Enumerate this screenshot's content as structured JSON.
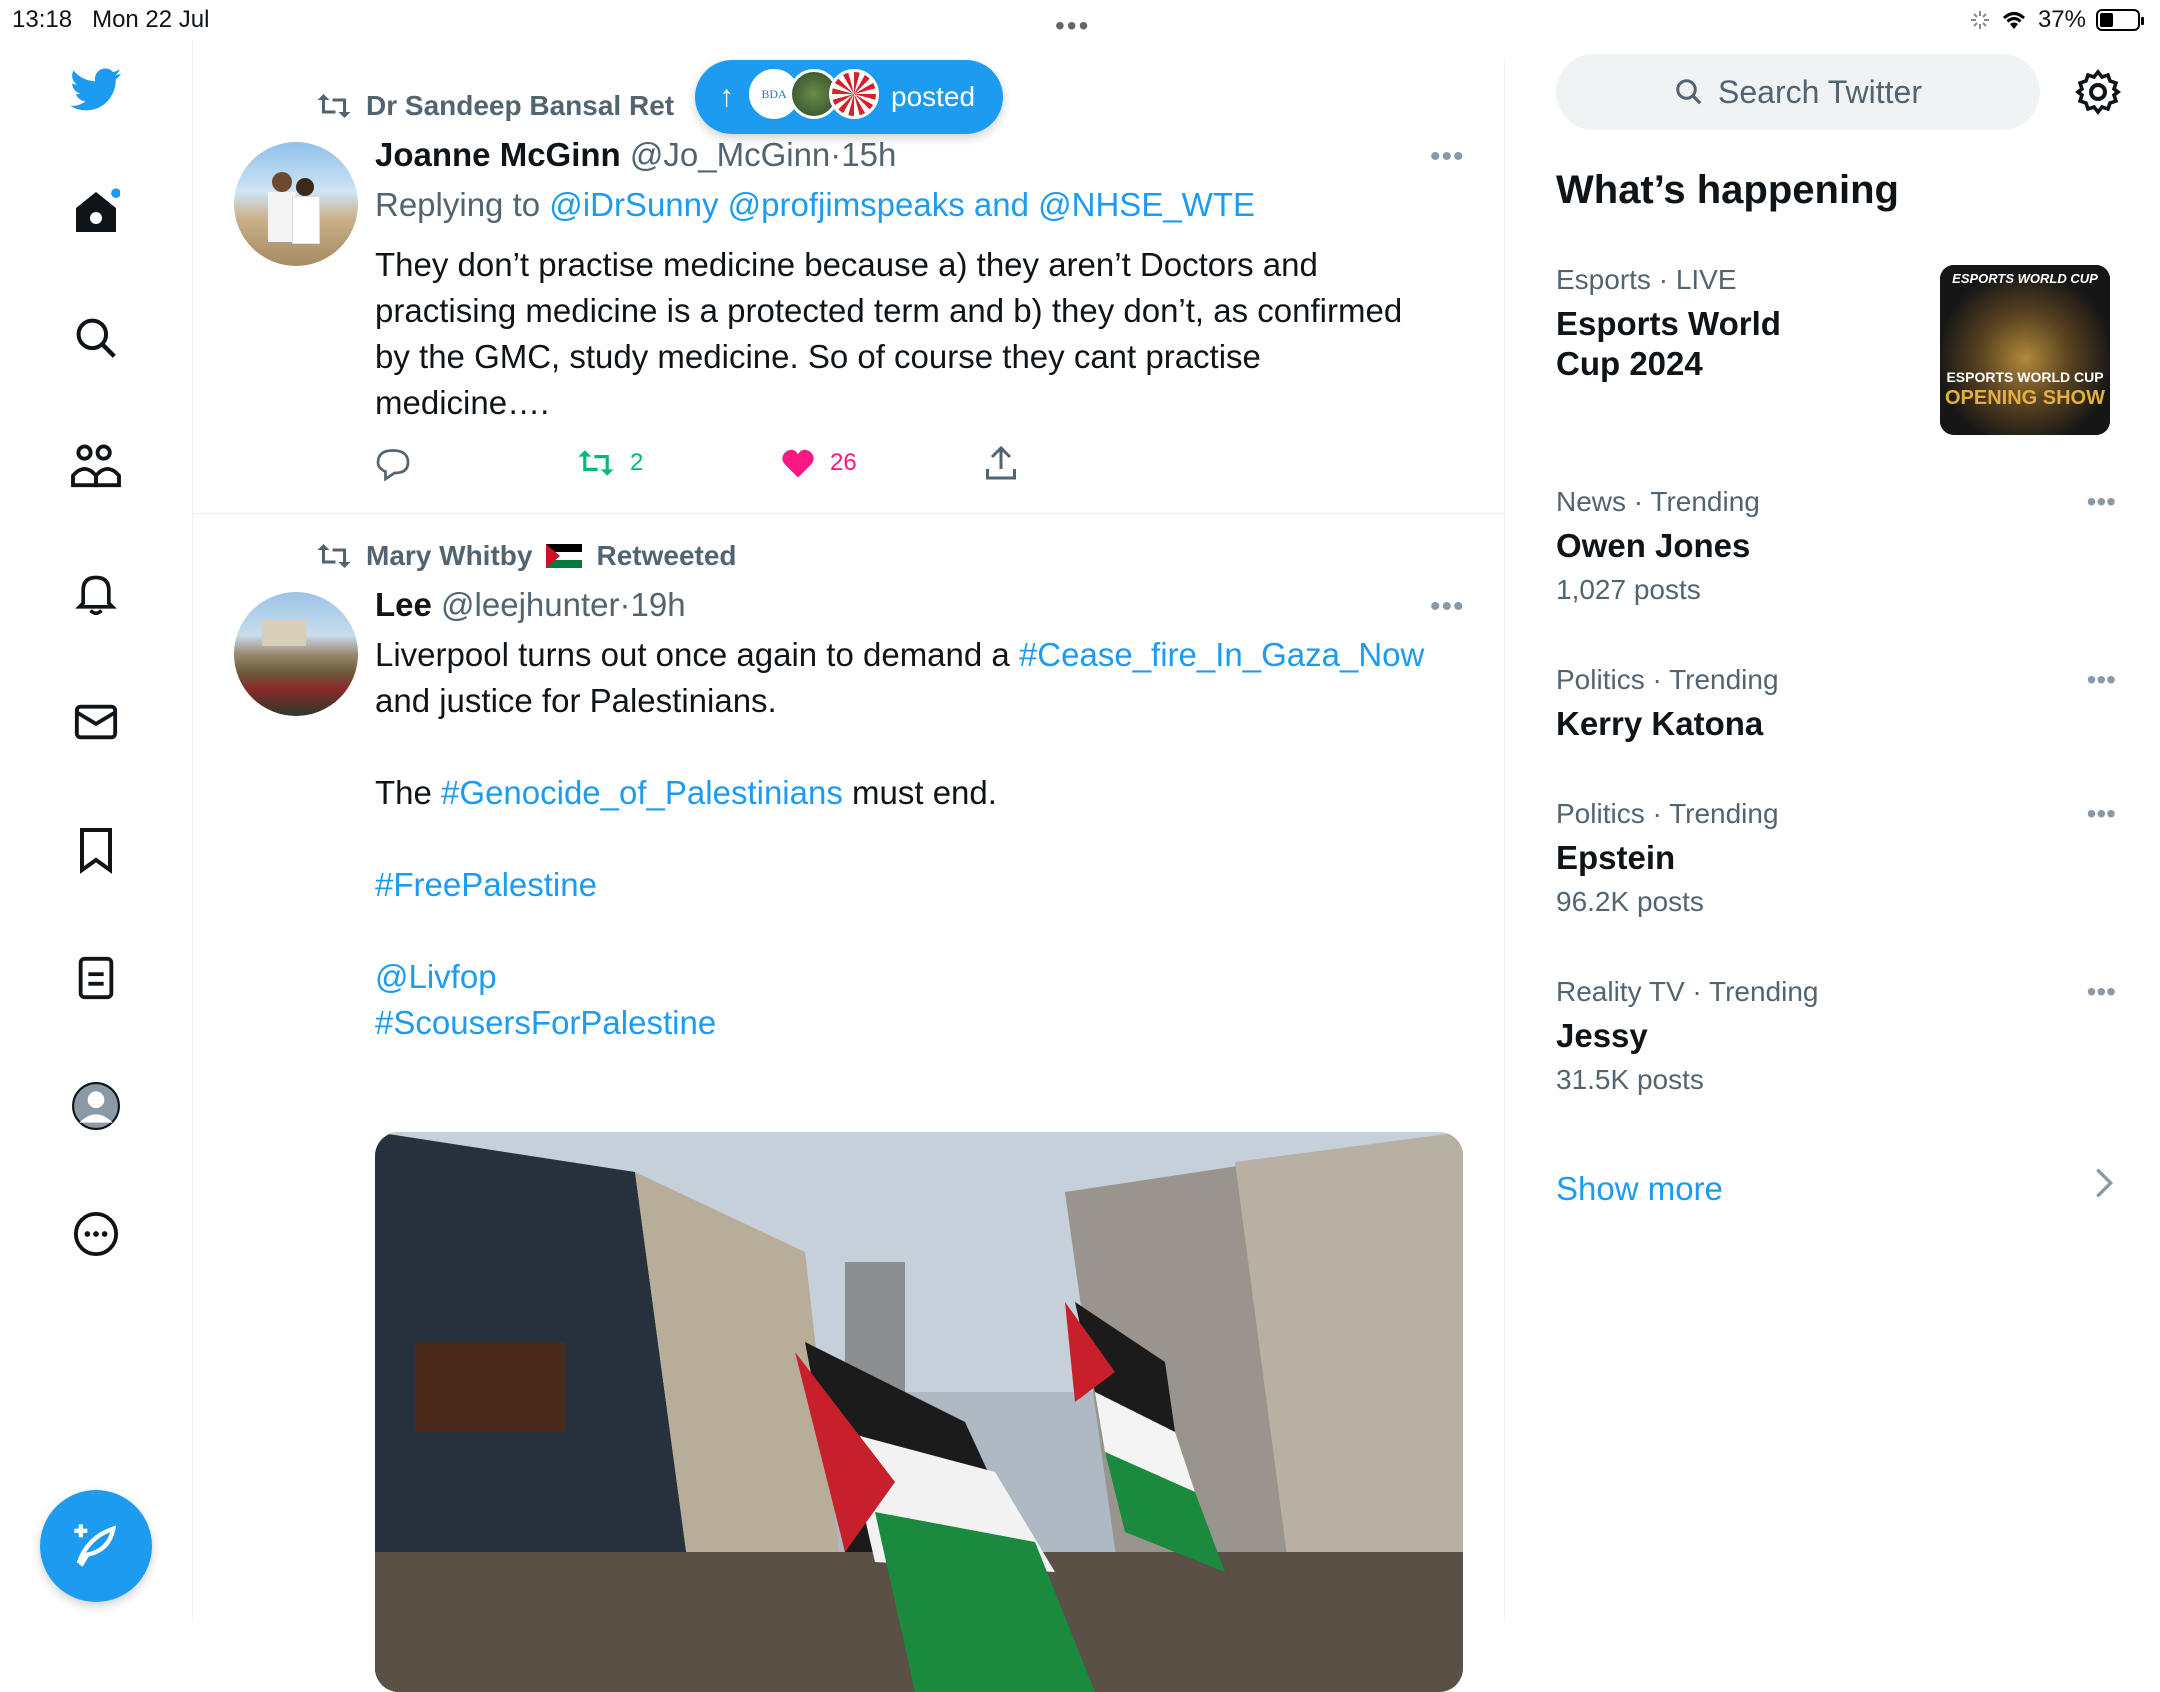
{
  "status_bar": {
    "time": "13:18",
    "date": "Mon 22 Jul",
    "battery": "37%",
    "battery_level": 0.37
  },
  "compose_pill": {
    "arrow": "↑",
    "label": "posted",
    "avatar_text": "BDA"
  },
  "tweets": [
    {
      "retweeted_by": "Dr Sandeep Bansal Ret",
      "name": "Joanne McGinn",
      "handle": "@Jo_McGinn",
      "sep": "·",
      "time": "15h",
      "replying_prefix": "Replying to",
      "replying_to": "@iDrSunny @profjimspeaks and @NHSE_WTE",
      "lines": [
        "They don’t practise medicine because a) they aren’t Doctors and",
        "practising medicine is a protected term and b) they don’t, as confirmed",
        "by the GMC, study medicine. So of course they cant practise",
        "medicine…."
      ],
      "retweets": "2",
      "likes": "26"
    },
    {
      "retweeted_by": "Mary Whitby",
      "retweeted_suffix": "Retweeted",
      "name": "Lee",
      "handle": "@leejhunter",
      "sep": "·",
      "time": "19h",
      "line1_text": "Liverpool turns out once again to demand a",
      "line1_tag": "#Cease_fire_In_Gaza_Now",
      "line2": "and justice for Palestinians.",
      "line3_pre": "The",
      "line3_tag": "#Genocide_of_Palestinians",
      "line3_post": "must end.",
      "tag_free": "#FreePalestine",
      "mention": "@Livfop",
      "tag_scousers": "#ScousersForPalestine"
    }
  ],
  "sidebar": {
    "search_placeholder": "Search Twitter",
    "title": "What’s happening",
    "featured": {
      "category": "Esports",
      "sep": "·",
      "status": "LIVE",
      "title_line1": "Esports World",
      "title_line2": "Cup 2024",
      "thumb_top": "ESPORTS WORLD CUP",
      "thumb_main": "ESPORTS WORLD CUP",
      "thumb_sub": "OPENING SHOW"
    },
    "trends": [
      {
        "category": "News · Trending",
        "name": "Owen Jones",
        "count": "1,027 posts"
      },
      {
        "category": "Politics · Trending",
        "name": "Kerry Katona",
        "count": ""
      },
      {
        "category": "Politics · Trending",
        "name": "Epstein",
        "count": "96.2K posts"
      },
      {
        "category": "Reality TV · Trending",
        "name": "Jessy",
        "count": "31.5K posts"
      }
    ],
    "show_more": "Show more"
  },
  "colors": {
    "accent": "#1d9bf0",
    "retweet_green": "#00ba7c",
    "like_pink": "#f91880",
    "muted": "#536471"
  },
  "icons": [
    "twitter-logo-icon",
    "home-icon",
    "search-icon",
    "communities-icon",
    "bell-icon",
    "mail-icon",
    "bookmark-icon",
    "list-icon",
    "profile-icon",
    "more-icon",
    "compose-icon",
    "retweet-icon",
    "reply-icon",
    "like-icon",
    "share-icon",
    "gear-icon",
    "chevron-right-icon",
    "wifi-icon",
    "battery-icon"
  ]
}
